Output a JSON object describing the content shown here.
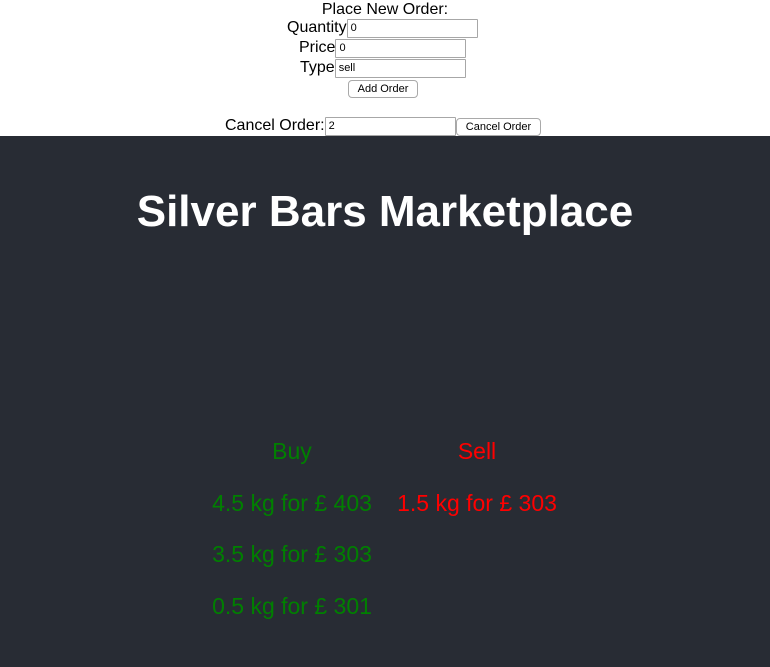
{
  "colors": {
    "buy": "#008000",
    "sell": "#ff0000",
    "panel_background": "#282c34",
    "title": "#ffffff"
  },
  "order_form": {
    "title": "Place New Order:",
    "quantity_label": "Quantity",
    "quantity_value": "0",
    "price_label": "Price",
    "price_value": "0",
    "type_label": "Type",
    "type_value": "sell",
    "add_button": "Add Order"
  },
  "cancel_form": {
    "label": "Cancel Order:",
    "order_id_value": "2",
    "cancel_button": "Cancel Order"
  },
  "marketplace": {
    "title": "Silver Bars Marketplace",
    "buy_header": "Buy",
    "sell_header": "Sell",
    "buy_orders": [
      "4.5 kg for £ 403",
      "3.5 kg for £ 303",
      "0.5 kg for £ 301"
    ],
    "sell_orders": [
      "1.5 kg for £ 303"
    ]
  }
}
